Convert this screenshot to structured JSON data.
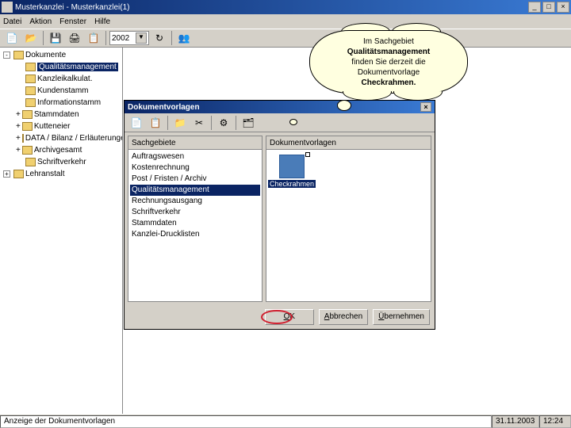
{
  "titlebar": {
    "title": "Musterkanzlei - Musterkanzlei(1)"
  },
  "menubar": [
    "Datei",
    "Aktion",
    "Fenster",
    "Hilfe"
  ],
  "toolbar": {
    "year": "2002"
  },
  "tree": {
    "root": "Dokumente",
    "items": [
      {
        "label": "Qualitätsmanagement",
        "selected": true
      },
      {
        "label": "Kanzleikalkulat."
      },
      {
        "label": "Kundenstamm"
      },
      {
        "label": "Informationstamm"
      },
      {
        "label": "Stammdaten",
        "plus": true
      },
      {
        "label": "Kutteneier",
        "plus": true
      },
      {
        "label": "DATA / Bilanz / Erläuterungen",
        "plus": true
      },
      {
        "label": "Archivgesamt",
        "plus": true
      },
      {
        "label": "Schriftverkehr"
      }
    ],
    "root2": "Lehranstalt"
  },
  "dialog": {
    "title": "Dokumentvorlagen",
    "left_header": "Sachgebiete",
    "right_header": "Dokumentvorlagen",
    "sachgebiete": [
      {
        "label": "Auftragswesen"
      },
      {
        "label": "Kostenrechnung"
      },
      {
        "label": "Post / Fristen / Archiv"
      },
      {
        "label": "Qualitätsmanagement",
        "selected": true
      },
      {
        "label": "Rechnungsausgang"
      },
      {
        "label": "Schriftverkehr"
      },
      {
        "label": "Stammdaten"
      },
      {
        "label": "Kanzlei-Drucklisten"
      }
    ],
    "doc_item": "Checkrahmen",
    "buttons": {
      "ok": "OK",
      "ok_u": "O",
      "cancel": "Abbrechen",
      "cancel_u": "A",
      "take": "Übernehmen",
      "take_u": "Ü"
    }
  },
  "cloud": {
    "line1": "Im Sachgebiet",
    "line2": "Qualitätsmanagement",
    "line3": "finden Sie derzeit die",
    "line4": "Dokumentvorlage",
    "line5": "Checkrahmen."
  },
  "statusbar": {
    "text": "Anzeige der Dokumentvorlagen",
    "date": "31.11.2003",
    "time": "12:24"
  }
}
